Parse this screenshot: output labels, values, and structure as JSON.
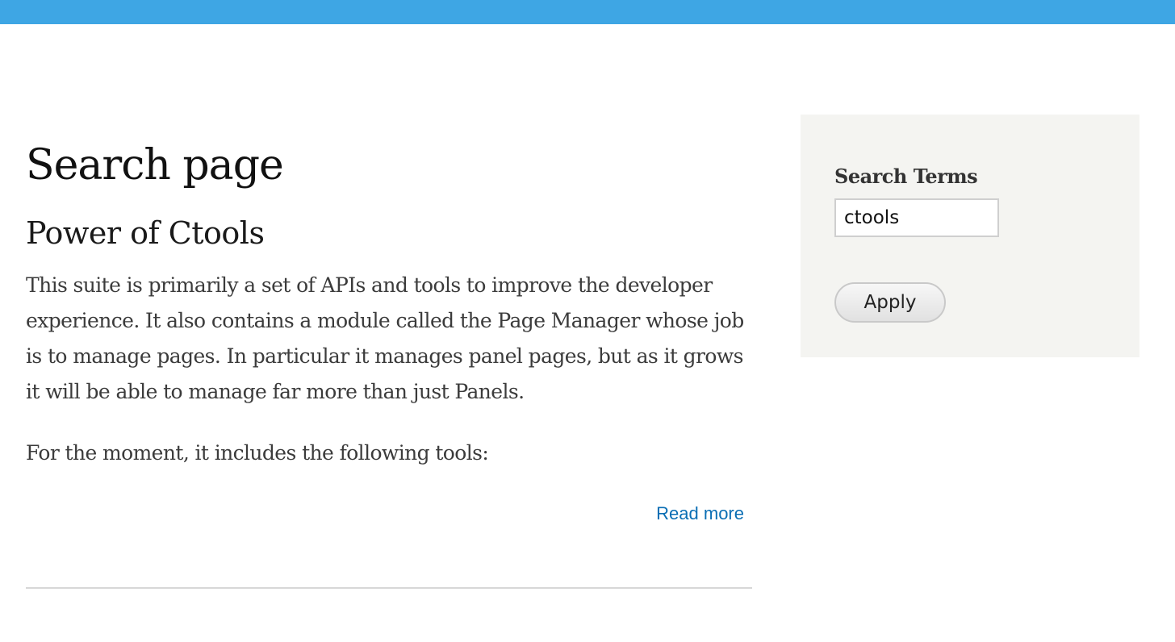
{
  "header": {
    "bar_color": "#3ea6e4"
  },
  "main": {
    "page_title": "Search page",
    "article": {
      "title": "Power of Ctools",
      "paragraph_1": "This suite is primarily a set of APIs and tools to improve the developer experience. It also contains a module called the Page Manager whose job is to manage pages. In particular it manages panel pages, but as it grows it will be able to manage far more than just Panels.",
      "paragraph_2": "For the moment, it includes the following tools:",
      "read_more_label": "Read more"
    }
  },
  "sidebar": {
    "filter_label": "Search Terms",
    "search_value": "ctools",
    "apply_label": "Apply"
  }
}
